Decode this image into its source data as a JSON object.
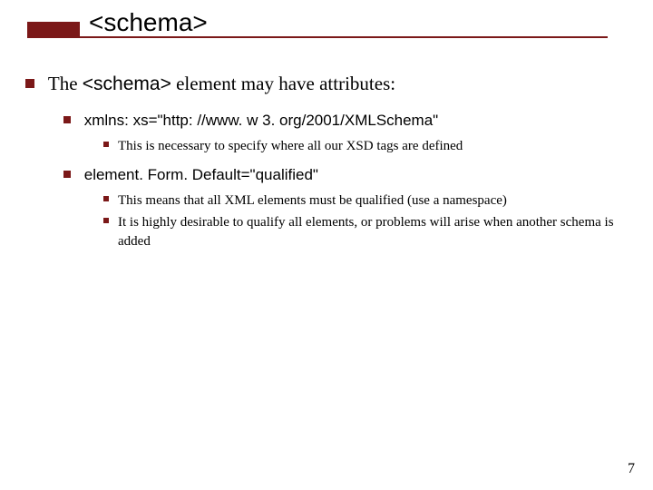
{
  "title": "<schema>",
  "body": {
    "intro_prefix": "The ",
    "intro_code": "<schema>",
    "intro_suffix": " element may have attributes:",
    "attr1": {
      "label": "xmlns: xs=\"http: //www. w 3. org/2001/XMLSchema\"",
      "notes": [
        "This is necessary to specify where all our XSD tags are defined"
      ]
    },
    "attr2": {
      "label": "element. Form. Default=\"qualified\"",
      "notes": [
        "This means that all XML elements must be qualified (use a namespace)",
        "It is highly desirable to qualify all elements, or problems will arise when another schema is added"
      ]
    }
  },
  "page_number": "7"
}
